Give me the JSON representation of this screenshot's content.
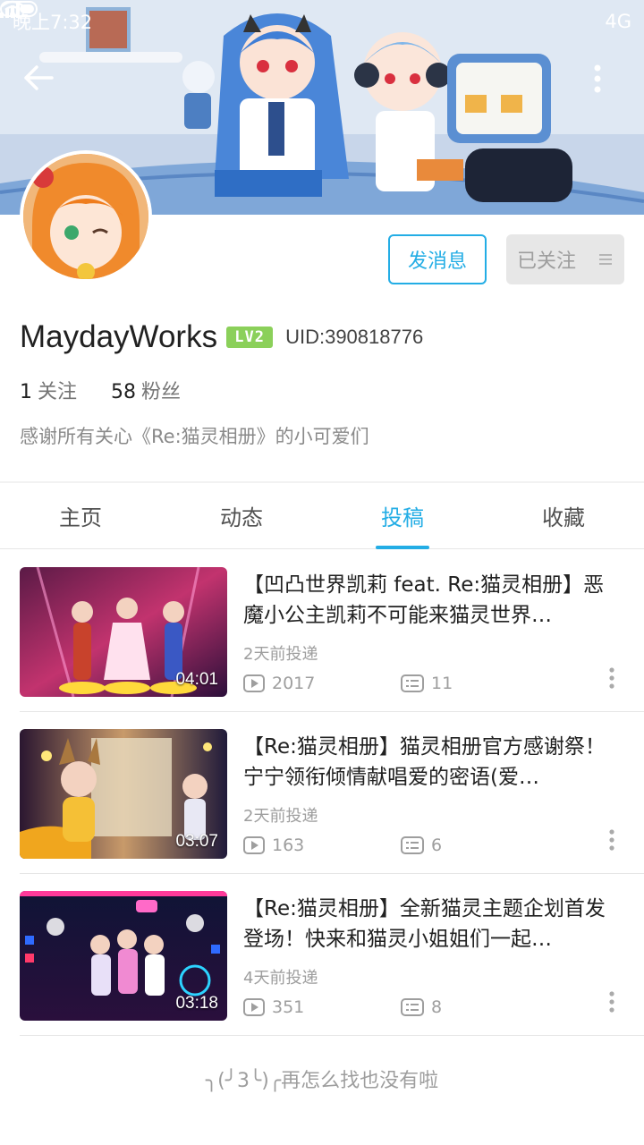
{
  "status_bar": {
    "time": "晚上7:32",
    "network": "4G",
    "signal_icon": "signal-icon",
    "wifi_icon": "wifi-icon",
    "battery_icon": "battery-icon"
  },
  "header": {
    "back_icon": "arrow-left-icon",
    "more_icon": "more-vertical-icon"
  },
  "profile": {
    "username": "MaydayWorks",
    "level": "LV2",
    "uid": "UID:390818776",
    "following_count": "1",
    "following_label": "关注",
    "followers_count": "58",
    "followers_label": "粉丝",
    "signature": "感谢所有关心《Re:猫灵相册》的小可爱们",
    "message_button": "发消息",
    "follow_button": "已关注"
  },
  "tabs": [
    {
      "label": "主页",
      "active": false
    },
    {
      "label": "动态",
      "active": false
    },
    {
      "label": "投稿",
      "active": true
    },
    {
      "label": "收藏",
      "active": false
    }
  ],
  "videos": [
    {
      "title": "【凹凸世界凯莉 feat. Re:猫灵相册】恶魔小公主凯莉不可能来猫灵世界…",
      "time": "2天前投递",
      "plays": "2017",
      "comments": "11",
      "duration": "04:01"
    },
    {
      "title": "【Re:猫灵相册】猫灵相册官方感谢祭！宁宁领衔倾情献唱爱的密语(爱…",
      "time": "2天前投递",
      "plays": "163",
      "comments": "6",
      "duration": "03:07"
    },
    {
      "title": "【Re:猫灵相册】全新猫灵主题企划首发登场！快来和猫灵小姐姐们一起…",
      "time": "4天前投递",
      "plays": "351",
      "comments": "8",
      "duration": "03:18"
    }
  ],
  "footer": {
    "end_message": "╮(╯3╰)╭再怎么找也没有啦"
  },
  "colors": {
    "accent": "#23ade5",
    "level_badge": "#8bd05a",
    "muted_text": "#9e9e9e"
  }
}
